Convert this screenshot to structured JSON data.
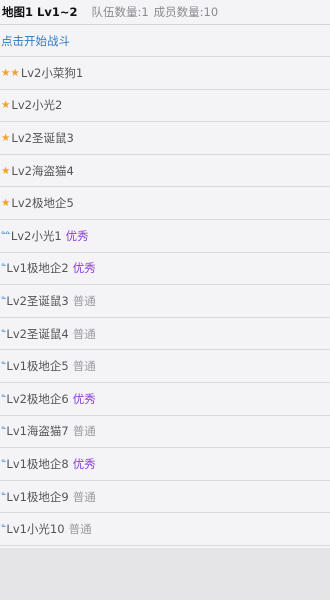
{
  "header": {
    "map": "地图1 Lv1~2",
    "team_count": "队伍数量:1",
    "member_count": "成员数量:10"
  },
  "start_battle": "点击开始战斗",
  "rows": [
    {
      "stars": "★★",
      "name": "Lv2小菜狗1"
    },
    {
      "stars": "★",
      "name": "Lv2小光2"
    },
    {
      "stars": "★",
      "name": "Lv2圣诞鼠3"
    },
    {
      "stars": "★",
      "name": "Lv2海盗猫4"
    },
    {
      "stars": "★",
      "name": "Lv2极地企5"
    },
    {
      "medal": "ᓐᓐ",
      "name": "Lv2小光1",
      "grade": "优秀"
    },
    {
      "medal": "ᓐ",
      "name": "Lv1极地企2",
      "grade": "优秀"
    },
    {
      "medal": "ᓐ",
      "name": "Lv2圣诞鼠3",
      "grade": "普通"
    },
    {
      "medal": "ᓐ",
      "name": "Lv2圣诞鼠4",
      "grade": "普通"
    },
    {
      "medal": "ᓐ",
      "name": "Lv1极地企5",
      "grade": "普通"
    },
    {
      "medal": "ᓐ",
      "name": "Lv2极地企6",
      "grade": "优秀"
    },
    {
      "medal": "ᓐ",
      "name": "Lv1海盗猫7",
      "grade": "普通"
    },
    {
      "medal": "ᓐ",
      "name": "Lv1极地企8",
      "grade": "优秀"
    },
    {
      "medal": "ᓐ",
      "name": "Lv1极地企9",
      "grade": "普通"
    },
    {
      "medal": "ᓐ",
      "name": "Lv1小光10",
      "grade": "普通"
    }
  ]
}
